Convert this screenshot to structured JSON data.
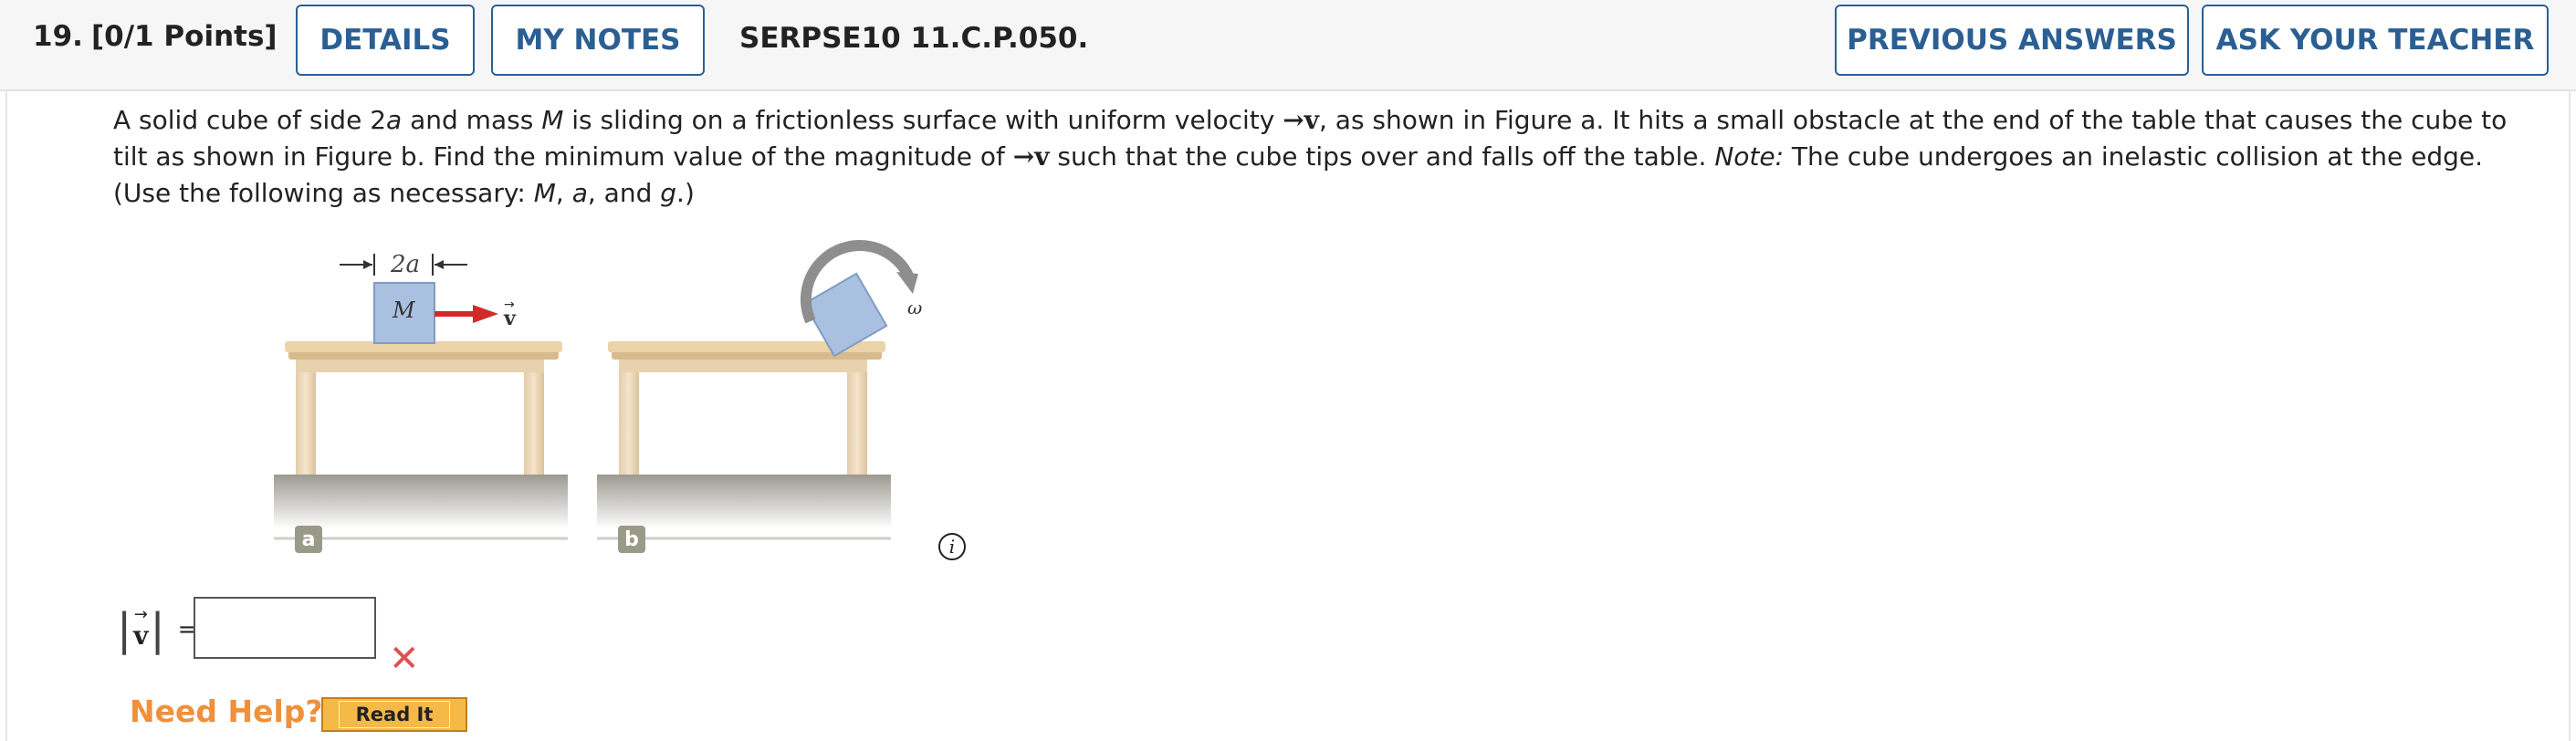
{
  "header": {
    "question_number": "19.",
    "points": "[0/1 Points]",
    "details_label": "DETAILS",
    "my_notes_label": "MY NOTES",
    "problem_code": "SERPSE10 11.C.P.050.",
    "previous_answers_label": "PREVIOUS ANSWERS",
    "ask_teacher_label": "ASK YOUR TEACHER"
  },
  "question": {
    "line1_a": "A solid cube of side 2",
    "var_a": "a",
    "line1_b": " and mass ",
    "var_M": "M",
    "line1_c": " is sliding on a frictionless surface with uniform velocity ",
    "vec_v": "v",
    "line1_d": ", as shown in Figure a. It hits a small obstacle at the end of the table that causes the cube to tilt as shown in Figure b. Find the minimum value of the magnitude of ",
    "line1_e": " such that the cube tips over and falls off the table. ",
    "note_label": "Note:",
    "line1_f": " The cube undergoes an inelastic collision at the edge. (Use the following as necessary: ",
    "vars_list_M": "M",
    "comma1": ", ",
    "vars_list_a": "a",
    "comma2": ", and ",
    "vars_list_g": "g",
    "end": ".)"
  },
  "figure": {
    "dimension_label": "2a",
    "mass_label": "M",
    "velocity_label": "v",
    "omega_label": "ω",
    "panel_a_label": "a",
    "panel_b_label": "b",
    "colors": {
      "cube": "#a9c0e0",
      "table_top": "#ecd3a8",
      "table_legs": "#eddcc0",
      "arrow": "#d12a2a",
      "rotation_arrow": "#8e8e8e"
    }
  },
  "info_icon": "info-icon",
  "answer": {
    "label_vec": "v",
    "equals": "=",
    "value": "",
    "status": "incorrect"
  },
  "help": {
    "need_help_label": "Need Help?",
    "read_it_label": "Read It"
  }
}
